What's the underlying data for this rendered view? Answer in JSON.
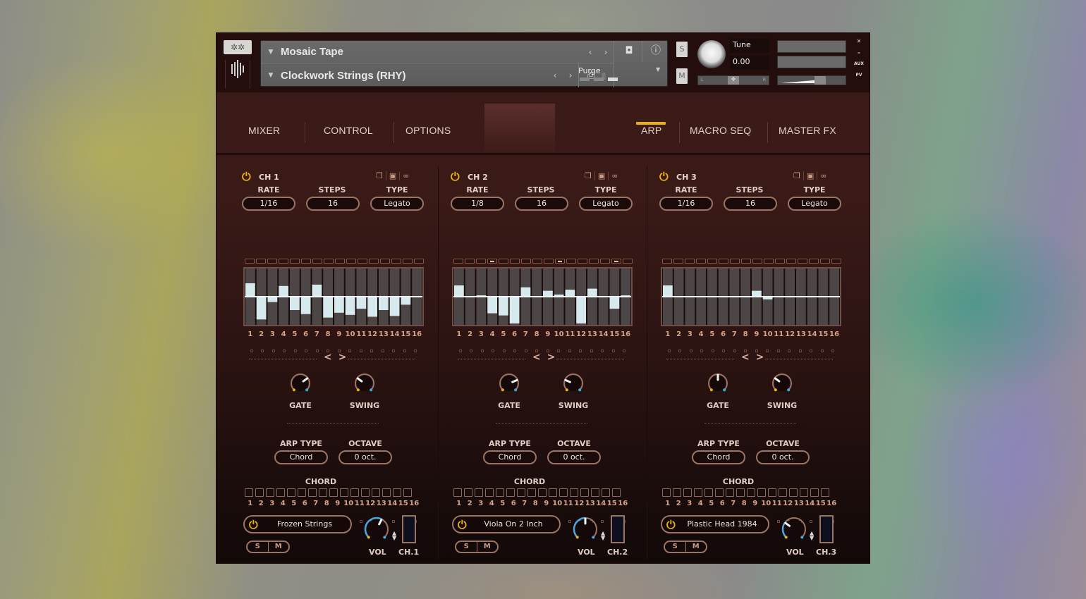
{
  "header": {
    "instrument_name": "Mosaic Tape",
    "preset_name": "Clockwork Strings (RHY)",
    "purge_label": "Purge",
    "solo_label": "S",
    "mute_label": "M",
    "tune_label": "Tune",
    "tune_value": "0.00",
    "pan_left": "L",
    "pan_right": "R",
    "window_controls": [
      "✕",
      "–",
      "AUX",
      "PV"
    ],
    "icons": [
      "gear-icon",
      "camera-icon",
      "info-icon",
      "save-icon",
      "delete-icon",
      "prev-icon",
      "next-icon"
    ]
  },
  "tabs": {
    "left": [
      {
        "label": "MIXER"
      },
      {
        "label": "CONTROL"
      },
      {
        "label": "OPTIONS"
      }
    ],
    "right": [
      {
        "label": "ARP",
        "active": true
      },
      {
        "label": "MACRO SEQ"
      },
      {
        "label": "MASTER FX"
      }
    ],
    "accent_color": "#e8b018"
  },
  "labels": {
    "rate": "RATE",
    "steps": "STEPS",
    "type": "TYPE",
    "gate": "GATE",
    "swing": "SWING",
    "arp_type": "ARP TYPE",
    "octave": "OCTAVE",
    "chord": "CHORD",
    "vol": "VOL",
    "solo": "S",
    "mute": "M",
    "nav": "< >"
  },
  "step_numbers": [
    "1",
    "2",
    "3",
    "4",
    "5",
    "6",
    "7",
    "8",
    "9",
    "10",
    "11",
    "12",
    "13",
    "14",
    "15",
    "16"
  ],
  "channels": [
    {
      "name": "CH 1",
      "rate": "1/16",
      "steps": "16",
      "type": "Legato",
      "arp_type": "Chord",
      "octave": "0 oct.",
      "gate": 0.7,
      "swing": 0.3,
      "instrument": "Frozen Strings",
      "out_label": "CH.1",
      "volume": 0.6,
      "active_leds": [],
      "step_values": [
        0.5,
        -0.85,
        -0.2,
        0.4,
        -0.5,
        -0.65,
        0.45,
        -0.78,
        -0.6,
        -0.68,
        -0.45,
        -0.75,
        -0.5,
        -0.72,
        -0.3,
        0
      ]
    },
    {
      "name": "CH 2",
      "rate": "1/8",
      "steps": "16",
      "type": "Legato",
      "arp_type": "Chord",
      "octave": "0 oct.",
      "gate": 0.75,
      "swing": 0.25,
      "instrument": "Viola On 2 Inch",
      "out_label": "CH.2",
      "volume": 0.5,
      "active_leds": [
        4,
        10,
        15
      ],
      "step_values": [
        0.42,
        0,
        0.05,
        -0.62,
        -0.7,
        -1.0,
        0.35,
        0,
        0.22,
        0.08,
        0.26,
        -1.0,
        0.3,
        0,
        -0.45,
        0.05
      ]
    },
    {
      "name": "CH 3",
      "rate": "1/16",
      "steps": "16",
      "type": "Legato",
      "arp_type": "Chord",
      "octave": "0 oct.",
      "gate": 0.5,
      "swing": 0.3,
      "instrument": "Plastic Head 1984",
      "out_label": "CH.3",
      "volume": 0.3,
      "active_leds": [],
      "step_values": [
        0.42,
        0,
        0,
        0,
        0,
        0,
        0,
        0,
        0.22,
        -0.1,
        0,
        0,
        0,
        0,
        0,
        0
      ]
    }
  ]
}
